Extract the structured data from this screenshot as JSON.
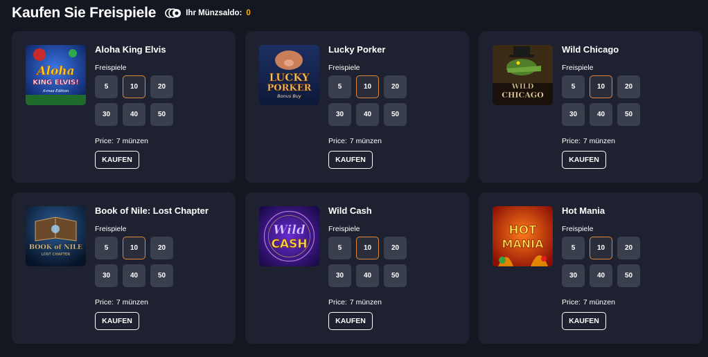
{
  "header": {
    "title": "Kaufen Sie Freispiele",
    "balance_label": "Ihr Münzsaldo:",
    "balance_value": "0",
    "coins_icon": "coins-icon"
  },
  "colors": {
    "background": "#141720",
    "card": "#1e2230",
    "option": "#3a3f4d",
    "selected_border": "#e0893c",
    "balance": "#f6b21a"
  },
  "cards": [
    {
      "title": "Aloha King Elvis",
      "section_label": "Freispiele",
      "options": [
        "5",
        "10",
        "20",
        "30",
        "40",
        "50"
      ],
      "selected": "10",
      "price_label": "Price:",
      "price_value": "7 münzen",
      "buy_label": "KAUFEN",
      "thumb_line1": "Aloha",
      "thumb_line2": "KING ELVIS!",
      "thumb_line3": "X-mas Edition"
    },
    {
      "title": "Lucky Porker",
      "section_label": "Freispiele",
      "options": [
        "5",
        "10",
        "20",
        "30",
        "40",
        "50"
      ],
      "selected": "10",
      "price_label": "Price:",
      "price_value": "7 münzen",
      "buy_label": "KAUFEN",
      "thumb_line1": "LUCKY",
      "thumb_line2": "PORKER",
      "thumb_line3": "Bonus Buy"
    },
    {
      "title": "Wild Chicago",
      "section_label": "Freispiele",
      "options": [
        "5",
        "10",
        "20",
        "30",
        "40",
        "50"
      ],
      "selected": "10",
      "price_label": "Price:",
      "price_value": "7 münzen",
      "buy_label": "KAUFEN",
      "thumb_line1": "WILD",
      "thumb_line2": "CHICAGO"
    },
    {
      "title": "Book of Nile: Lost Chapter",
      "section_label": "Freispiele",
      "options": [
        "5",
        "10",
        "20",
        "30",
        "40",
        "50"
      ],
      "selected": "10",
      "price_label": "Price:",
      "price_value": "7 münzen",
      "buy_label": "KAUFEN",
      "thumb_line1": "BOOK of NILE",
      "thumb_line2": "LOST CHAPTER"
    },
    {
      "title": "Wild Cash",
      "section_label": "Freispiele",
      "options": [
        "5",
        "10",
        "20",
        "30",
        "40",
        "50"
      ],
      "selected": "10",
      "price_label": "Price:",
      "price_value": "7 münzen",
      "buy_label": "KAUFEN",
      "thumb_line1": "Wild",
      "thumb_line2": "CASH"
    },
    {
      "title": "Hot Mania",
      "section_label": "Freispiele",
      "options": [
        "5",
        "10",
        "20",
        "30",
        "40",
        "50"
      ],
      "selected": "10",
      "price_label": "Price:",
      "price_value": "7 münzen",
      "buy_label": "KAUFEN",
      "thumb_line1": "HOT",
      "thumb_line2": "MANIA"
    }
  ]
}
